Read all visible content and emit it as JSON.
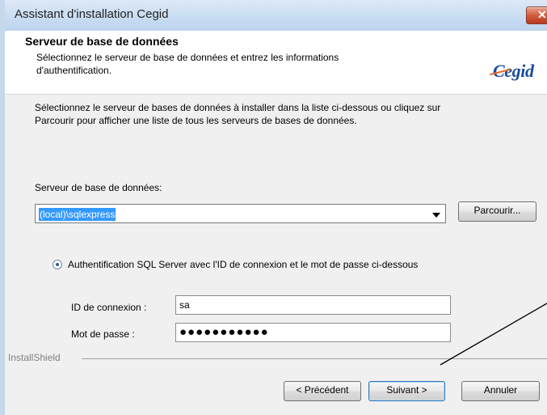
{
  "window": {
    "title": "Assistant d'installation Cegid",
    "close_icon": "✕"
  },
  "header": {
    "title": "Serveur de base de données",
    "subtitle": "Sélectionnez le serveur de base de données et entrez les informations d'authentification.",
    "logo": "Cegid"
  },
  "main": {
    "intro": "Sélectionnez le serveur de bases de données à installer dans la liste ci-dessous ou cliquez sur Parcourir pour afficher une liste de tous les serveurs de bases de données.",
    "server_label": "Serveur de base de données:",
    "server_value": "(local)\\sqlexpress",
    "browse_label": "Parcourir...",
    "auth_label": "Authentification SQL Server avec l'ID de connexion et le mot de passe ci-dessous",
    "login_label": "ID de connexion :",
    "login_value": "sa",
    "password_label": "Mot de passe :",
    "password_value": "●●●●●●●●●●●"
  },
  "footer": {
    "installshield": "InstallShield",
    "previous": "< Précédent",
    "next": "Suivant >",
    "cancel": "Annuler"
  },
  "colors": {
    "selection": "#3399ff",
    "title_gradient_top": "#dde9f6",
    "title_gradient_bottom": "#bdd4ee",
    "close_button": "#d35a3c",
    "logo": "#1a4d9c"
  },
  "icons": {
    "close": "close-icon",
    "dropdown": "dropdown-arrow-icon",
    "radio": "radio-selected-icon"
  }
}
